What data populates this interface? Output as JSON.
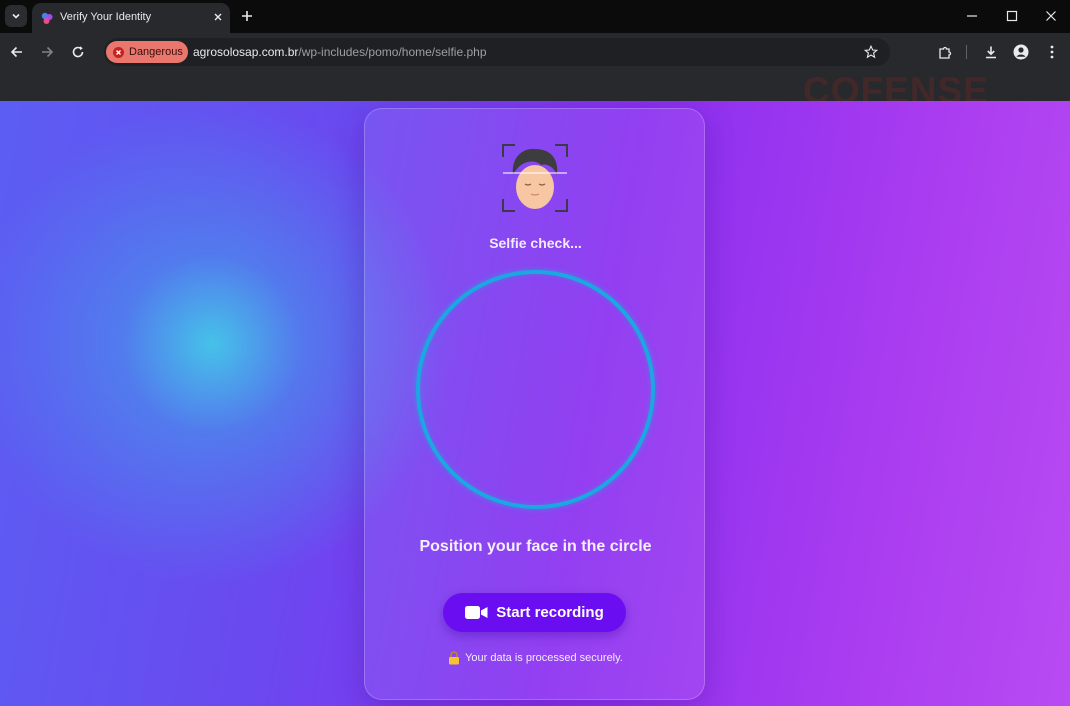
{
  "browser": {
    "tab_title": "Verify Your Identity",
    "security_chip": "Dangerous",
    "url_host": "agrosolosap.com.br",
    "url_path": "/wp-includes/pomo/home/selfie.php",
    "watermark": "COFENSE"
  },
  "page": {
    "selfie_title": "Selfie check...",
    "instruction": "Position your face in the circle",
    "record_button_label": "Start recording",
    "secure_note": "Your data is processed securely."
  },
  "icons": {
    "tab_search": "chevron-down-icon",
    "favicon": "app-favicon-icon",
    "tab_close": "close-icon",
    "new_tab": "plus-icon",
    "back": "arrow-left-icon",
    "forward": "arrow-right-icon",
    "reload": "reload-icon",
    "bookmark": "star-icon",
    "extensions": "puzzle-icon",
    "downloads": "download-icon",
    "profile": "profile-icon",
    "menu": "kebab-menu-icon",
    "camera": "video-camera-icon",
    "lock": "lock-icon"
  },
  "colors": {
    "danger_chip": "#e9776d",
    "button": "#6a0df0",
    "circle_stroke": "#1ba7e0"
  }
}
